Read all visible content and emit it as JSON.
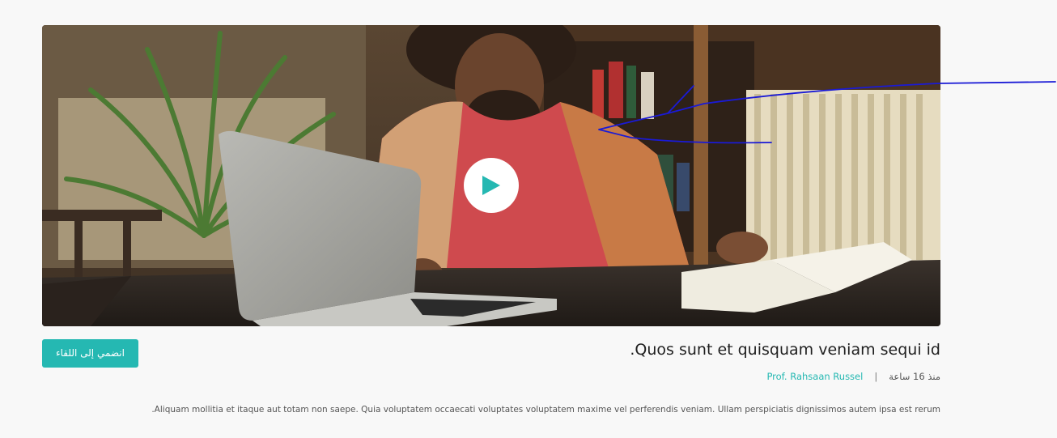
{
  "video": {
    "thumbnail_alt": "student working on laptop with book",
    "play_icon": "play-icon"
  },
  "card": {
    "join_label": "انضمي إلى اللقاء",
    "title": ".Quos sunt et quisquam veniam sequi id",
    "time_ago": "منذ 16 ساعة",
    "separator": "|",
    "author": "Prof. Rahsaan Russel",
    "description": ".Aliquam mollitia et itaque aut totam non saepe. Quia voluptatem occaecati voluptates voluptatem maxime vel perferendis veniam. Ullam perspiciatis dignissimos autem ipsa est rerum"
  },
  "colors": {
    "accent": "#25b8b2",
    "annotation": "#1a1ad6",
    "background": "#f8f8f8"
  }
}
